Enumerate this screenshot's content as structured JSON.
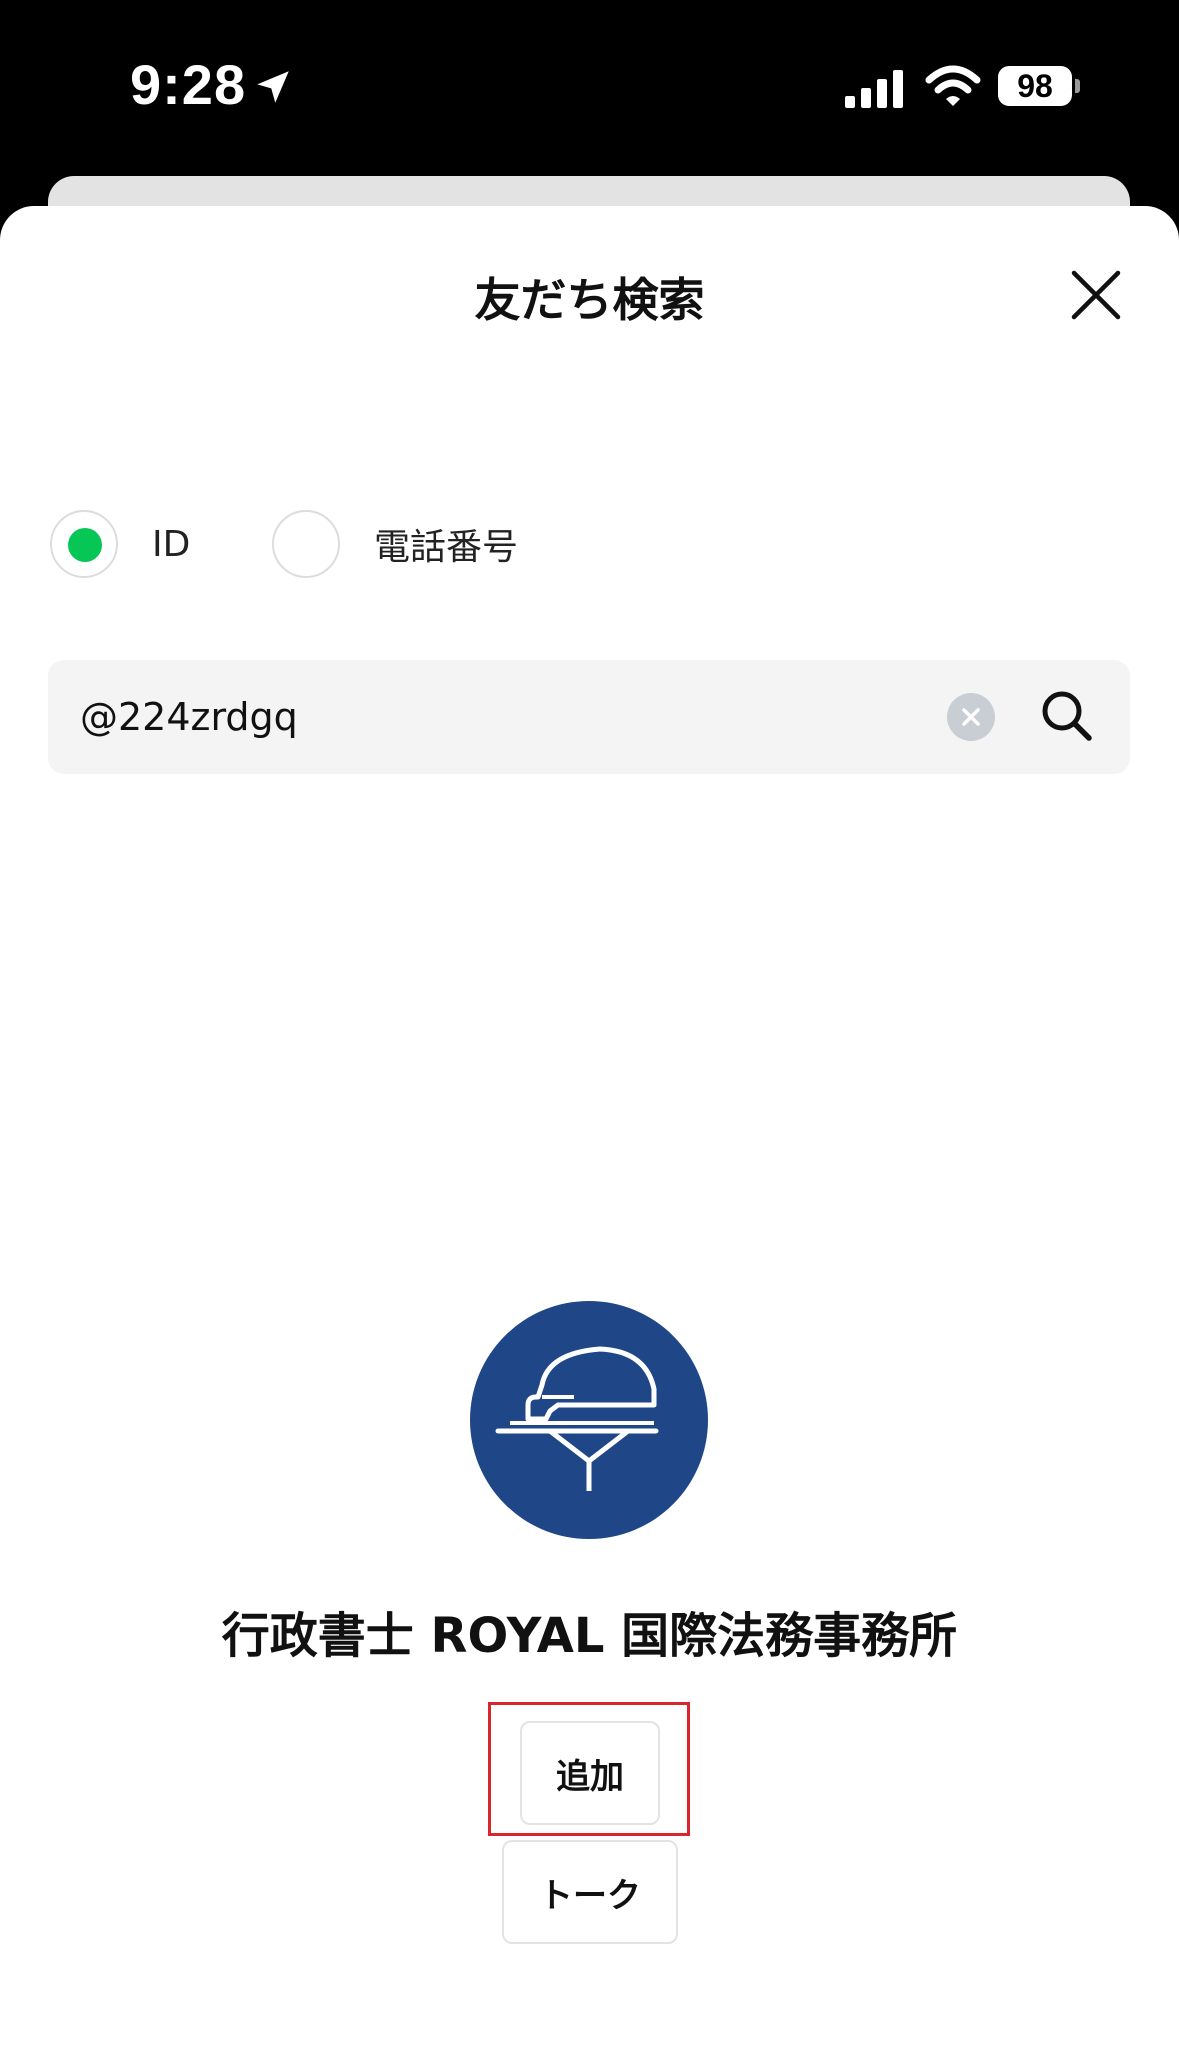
{
  "status_bar": {
    "time": "9:28",
    "battery": "98"
  },
  "sheet": {
    "title": "友だち検索"
  },
  "search_type": {
    "options": [
      {
        "label": "ID",
        "selected": true
      },
      {
        "label": "電話番号",
        "selected": false
      }
    ]
  },
  "search": {
    "value": "@224zrdgq"
  },
  "result": {
    "name": "行政書士 ROYAL 国際法務事務所",
    "add_label": "追加",
    "talk_label": "トーク"
  },
  "colors": {
    "accent": "#06c755",
    "avatar_bg": "#1f4788",
    "highlight": "#d9262e"
  },
  "icons": [
    "location-arrow-icon",
    "signal-icon",
    "wifi-icon",
    "battery-icon",
    "close-icon",
    "clear-icon",
    "search-icon",
    "helmet-logo"
  ]
}
